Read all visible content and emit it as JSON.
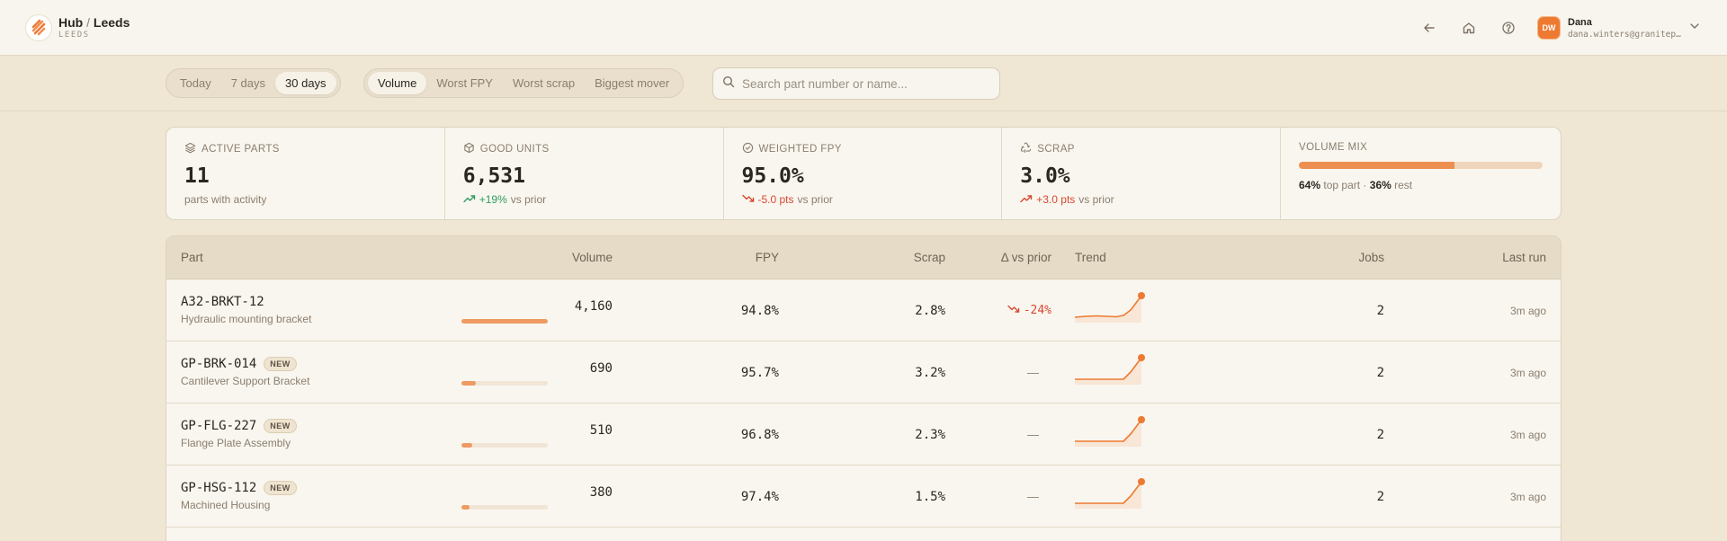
{
  "header": {
    "hub": "Hub",
    "separator": "/",
    "site": "Leeds",
    "site_code": "LEEDS",
    "user": {
      "initials": "DW",
      "name": "Dana",
      "email": "dana.winters@granitep…"
    }
  },
  "filters": {
    "period_options": [
      "Today",
      "7 days",
      "30 days"
    ],
    "period_selected": "30 days",
    "sort_options": [
      "Volume",
      "Worst FPY",
      "Worst scrap",
      "Biggest mover"
    ],
    "sort_selected": "Volume",
    "search_placeholder": "Search part number or name..."
  },
  "kpis": {
    "active_parts": {
      "label": "Active parts",
      "value": "11",
      "sub": "parts with activity"
    },
    "good_units": {
      "label": "Good units",
      "value": "6,531",
      "delta": "+19%",
      "suffix": "vs prior"
    },
    "weighted_fpy": {
      "label": "Weighted FPY",
      "value": "95.0%",
      "delta": "-5.0 pts",
      "suffix": "vs prior"
    },
    "scrap": {
      "label": "Scrap",
      "value": "3.0%",
      "delta": "+3.0 pts",
      "suffix": "vs prior"
    },
    "volume_mix": {
      "label": "Volume mix",
      "top_pct": "64%",
      "top_label": "top part",
      "dot": "·",
      "rest_pct": "36%",
      "rest_label": "rest",
      "top_fraction": 0.64
    }
  },
  "table": {
    "columns": [
      "Part",
      "Volume",
      "FPY",
      "Scrap",
      "Δ vs prior",
      "Trend",
      "Jobs",
      "Last run"
    ],
    "rows": [
      {
        "code": "A32-BRKT-12",
        "name": "Hydraulic mounting bracket",
        "badge": "",
        "volume": "4,160",
        "volume_fraction": 1.0,
        "fpy": "94.8%",
        "scrap": "2.8%",
        "delta": "-24%",
        "jobs": "2",
        "last_run": "3m ago"
      },
      {
        "code": "GP-BRK-014",
        "name": "Cantilever Support Bracket",
        "badge": "NEW",
        "volume": "690",
        "volume_fraction": 0.166,
        "fpy": "95.7%",
        "scrap": "3.2%",
        "delta": "—",
        "jobs": "2",
        "last_run": "3m ago"
      },
      {
        "code": "GP-FLG-227",
        "name": "Flange Plate Assembly",
        "badge": "NEW",
        "volume": "510",
        "volume_fraction": 0.123,
        "fpy": "96.8%",
        "scrap": "2.3%",
        "delta": "—",
        "jobs": "2",
        "last_run": "3m ago"
      },
      {
        "code": "GP-HSG-112",
        "name": "Machined Housing",
        "badge": "NEW",
        "volume": "380",
        "volume_fraction": 0.091,
        "fpy": "97.4%",
        "scrap": "1.5%",
        "delta": "—",
        "jobs": "2",
        "last_run": "3m ago"
      }
    ]
  },
  "colors": {
    "accent": "#ee7a32",
    "good": "#2e9c5d",
    "bad": "#d9472f",
    "background": "#efe6d3",
    "surface": "#f9f6ef"
  },
  "icons": [
    "logo-icon",
    "back-arrow-icon",
    "home-icon",
    "help-icon",
    "chevron-down-icon",
    "search-icon",
    "layers-icon",
    "box-icon",
    "check-circle-icon",
    "recycle-icon",
    "trend-up-icon",
    "trend-down-icon"
  ]
}
